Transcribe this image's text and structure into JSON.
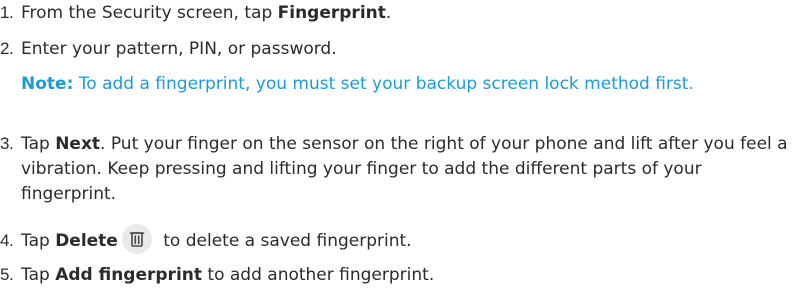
{
  "steps": [
    {
      "num": "1.",
      "pre": "From the Security screen, tap ",
      "bold": "Fingerprint",
      "post": "."
    },
    {
      "num": "2.",
      "text": "Enter your pattern, PIN, or password."
    },
    {
      "num": "3.",
      "pre": "Tap ",
      "bold": "Next",
      "post": ". Put your finger on the sensor on the right of your phone and lift after you feel a vibration. Keep pressing and lifting your finger to add the different parts of your fingerprint."
    },
    {
      "num": "4.",
      "pre": "Tap ",
      "bold": "Delete",
      "post": " to delete a saved fingerprint.",
      "icon": "trash-icon"
    },
    {
      "num": "5.",
      "pre": "Tap ",
      "bold": "Add fingerprint",
      "post": " to add another fingerprint."
    }
  ],
  "note": {
    "label": "Note:",
    "text": " To add a fingerprint, you must set your backup screen lock method first."
  },
  "colors": {
    "text": "#2b2b2b",
    "note": "#1a9cd8",
    "icon_bg": "#e9e9e9",
    "icon_fg": "#4a4a4a"
  }
}
